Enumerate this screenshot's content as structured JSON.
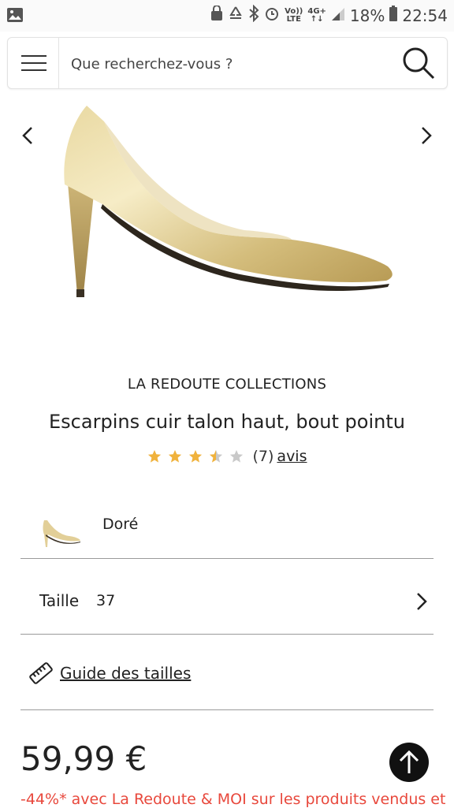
{
  "status_bar": {
    "volte_top": "Vo))",
    "volte_bottom": "LTE",
    "network_top": "4G+",
    "network_bottom": "↑↓",
    "battery": "18%",
    "time": "22:54",
    "icons": [
      "gallery-icon",
      "lock-icon",
      "recycle-icon",
      "bluetooth-icon",
      "alarm-icon",
      "volte-icon",
      "network-icon",
      "signal-icon",
      "battery-icon"
    ]
  },
  "search": {
    "placeholder": "Que recherchez-vous ?"
  },
  "product": {
    "brand": "LA REDOUTE COLLECTIONS",
    "title": "Escarpins cuir talon haut, bout pointu",
    "rating_value": 3.5,
    "rating_max": 5,
    "reviews_count": "(7)",
    "reviews_link": "avis",
    "color_label": "Doré",
    "size_label": "Taille",
    "size_value": "37",
    "size_guide": "Guide des tailles",
    "price": "59,99 €",
    "promo": "-44%* avec La Redoute & MOI sur les produits vendus et"
  },
  "colors": {
    "star_filled": "#f0b23c",
    "star_empty": "#c9c9c9",
    "promo": "#e8483c",
    "scroll_button": "#111111"
  }
}
